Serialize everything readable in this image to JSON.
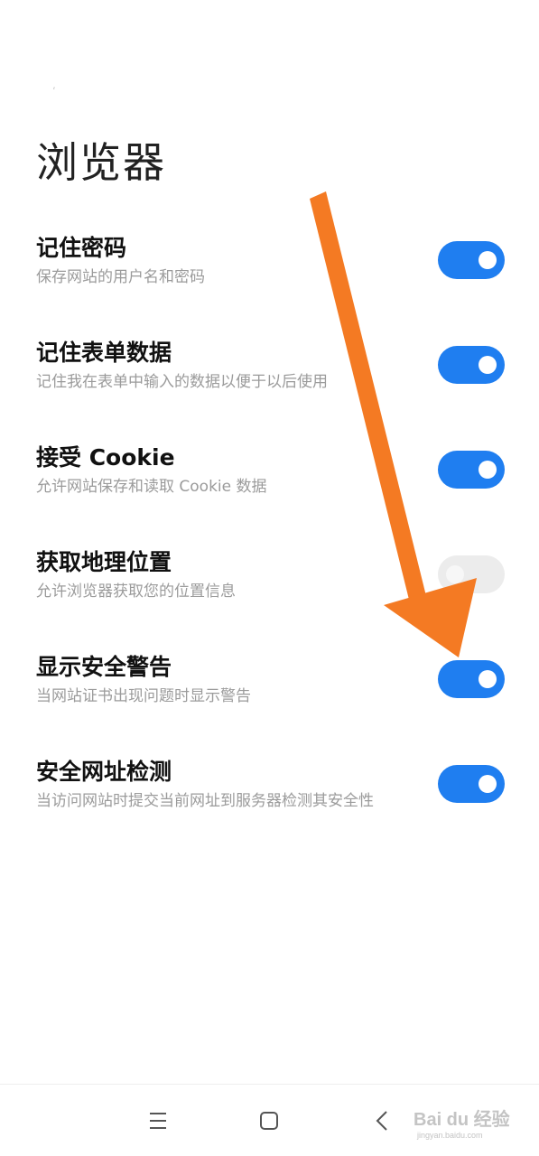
{
  "page": {
    "title": "浏览器"
  },
  "settings": [
    {
      "title": "记住密码",
      "description": "保存网站的用户名和密码",
      "enabled": true
    },
    {
      "title": "记住表单数据",
      "description": "记住我在表单中输入的数据以便于以后使用",
      "enabled": true
    },
    {
      "title": "接受 Cookie",
      "description": "允许网站保存和读取 Cookie 数据",
      "enabled": true
    },
    {
      "title": "获取地理位置",
      "description": "允许浏览器获取您的位置信息",
      "enabled": false
    },
    {
      "title": "显示安全警告",
      "description": "当网站证书出现问题时显示警告",
      "enabled": true
    },
    {
      "title": "安全网址检测",
      "description": "当访问网站时提交当前网址到服务器检测其安全性",
      "enabled": true
    }
  ],
  "colors": {
    "toggle_on": "#1f7ef0",
    "toggle_off": "#ececec",
    "arrow": "#f47a23"
  },
  "icons": {
    "nav_menu": "menu-icon",
    "nav_home": "home-square-icon",
    "nav_back": "back-chevron-icon"
  },
  "watermark": {
    "main": "Bai du 经验",
    "sub": "jingyan.baidu.com"
  }
}
